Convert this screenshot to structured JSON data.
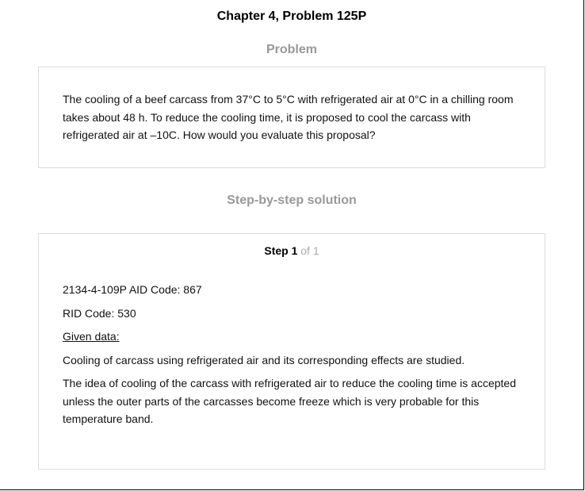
{
  "header": {
    "chapter_title": "Chapter 4, Problem 125P"
  },
  "problem": {
    "heading": "Problem",
    "text": "The cooling of a beef carcass from 37°C to 5°C with refrigerated air at 0°C in a chilling room takes about 48 h. To reduce the cooling time, it is proposed to cool the carcass with refrigerated air at –10C. How would you evaluate this proposal?"
  },
  "solution": {
    "heading": "Step-by-step solution",
    "step_label": "Step 1",
    "step_of": "of 1",
    "lines": [
      "2134-4-109P AID Code: 867",
      "RID Code: 530",
      "Given data:",
      "Cooling of carcass using refrigerated air and its corresponding effects are studied.",
      "The idea of cooling of the carcass with refrigerated air to reduce the cooling time is accepted unless the outer parts of the carcasses become freeze which is very probable for this temperature band."
    ]
  }
}
